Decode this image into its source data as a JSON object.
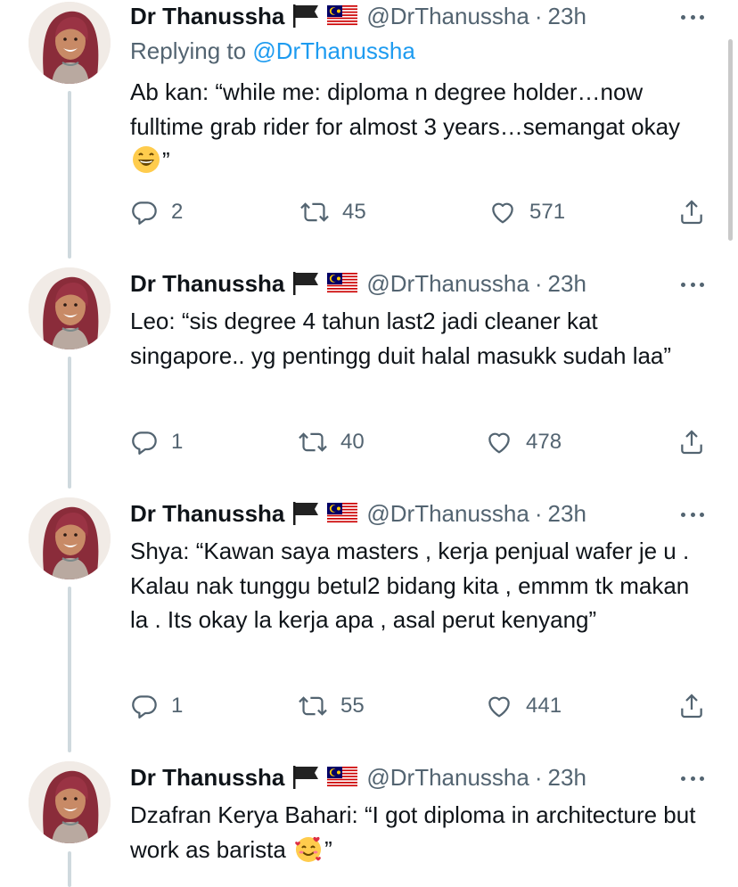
{
  "tweets": [
    {
      "name": "Dr Thanussha",
      "handle": "@DrThanussha",
      "separator": "·",
      "time": "23h",
      "replying_label": "Replying to",
      "replying_mention": "@DrThanussha",
      "text_before_emoji": "Ab kan: “while me: diploma n degree holder…now fulltime grab rider for almost 3 years…semangat okay ",
      "emoji": "grinning-face-emoji",
      "text_after_emoji": "”",
      "replies": "2",
      "retweets": "45",
      "likes": "571"
    },
    {
      "name": "Dr Thanussha",
      "handle": "@DrThanussha",
      "separator": "·",
      "time": "23h",
      "text": "Leo: “sis degree 4 tahun last2 jadi cleaner kat singapore.. yg pentingg duit halal masukk sudah laa”",
      "replies": "1",
      "retweets": "40",
      "likes": "478"
    },
    {
      "name": "Dr Thanussha",
      "handle": "@DrThanussha",
      "separator": "·",
      "time": "23h",
      "text": "Shya: “Kawan saya masters , kerja penjual wafer je u . Kalau nak tunggu betul2 bidang kita , emmm tk makan la . Its okay la kerja apa , asal perut kenyang”",
      "replies": "1",
      "retweets": "55",
      "likes": "441"
    },
    {
      "name": "Dr Thanussha",
      "handle": "@DrThanussha",
      "separator": "·",
      "time": "23h",
      "text_before_emoji": "Dzafran Kerya Bahari: “I got diploma in architecture but work as barista ",
      "emoji": "smiling-face-with-hearts-emoji",
      "text_after_emoji": "”"
    }
  ],
  "icons": {
    "black_flag": "black-flag-icon",
    "malaysia_flag": "malaysia-flag-icon",
    "more": "more-icon",
    "reply": "reply-icon",
    "retweet": "retweet-icon",
    "like": "like-icon",
    "share": "share-icon"
  },
  "colors": {
    "text": "#0f1419",
    "secondary": "#536471",
    "link": "#1d9bf0",
    "thread_line": "#cfd9de"
  }
}
